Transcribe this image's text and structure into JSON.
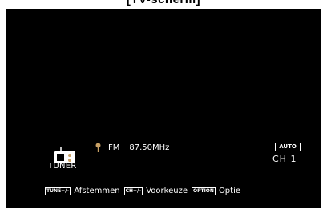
{
  "heading": "[TV-scherm]",
  "source": {
    "icon": "radio-icon",
    "label": "TUNER"
  },
  "tuner": {
    "band_icon": "antenna-icon",
    "band": "FM",
    "frequency": "87.50MHz"
  },
  "mode_badge": "AUTO",
  "channel": "CH 1",
  "guide": [
    {
      "key": "TUNE+/–",
      "label": "Afstemmen"
    },
    {
      "key": "CH+/–",
      "label": "Voorkeuze"
    },
    {
      "key": "OPTION",
      "label": "Optie"
    }
  ],
  "colors": {
    "screen_bg": "#000000",
    "text": "#ffffff",
    "radio_dial": "#c8a064"
  }
}
